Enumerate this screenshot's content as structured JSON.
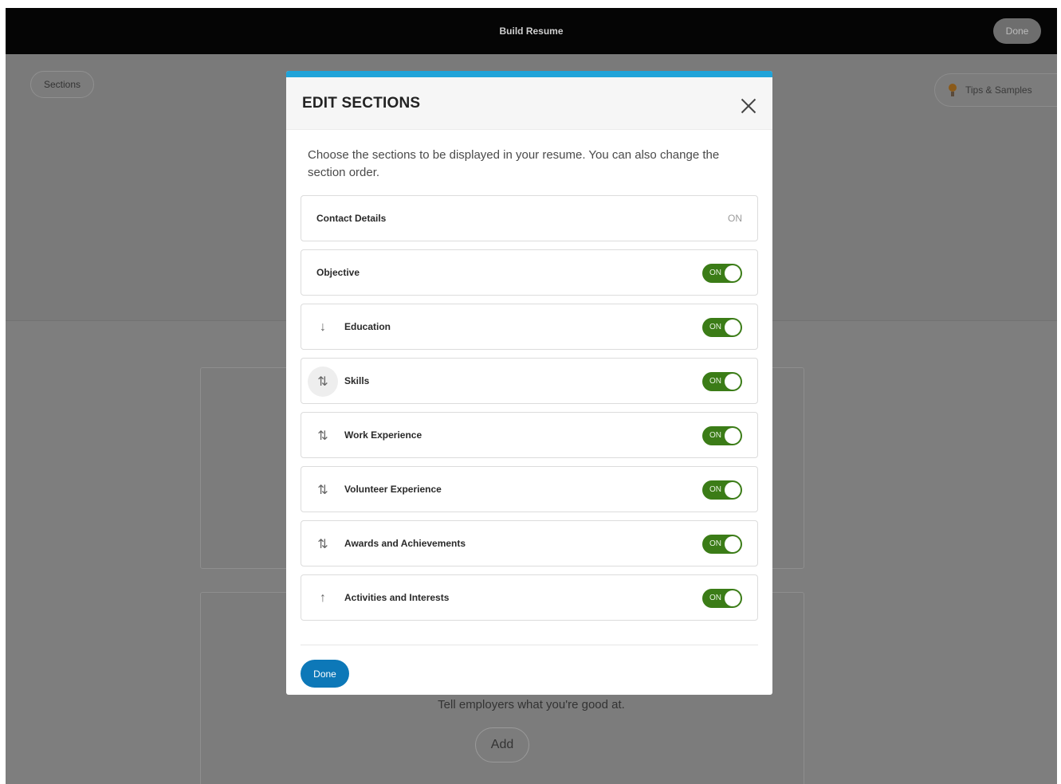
{
  "topbar": {
    "title": "Build Resume",
    "done_label": "Done"
  },
  "background": {
    "sections_label": "Sections",
    "tips_label": "Tips & Samples",
    "skills_card": {
      "description": "Tell employers what you're good at.",
      "add_label": "Add"
    }
  },
  "modal": {
    "title": "EDIT SECTIONS",
    "description": "Choose the sections to be displayed in your resume. You can also change the section order.",
    "done_label": "Done",
    "toggle_on_label": "ON",
    "rows": [
      {
        "label": "Contact Details",
        "status": "ON",
        "move_icon": "none",
        "toggle": "static"
      },
      {
        "label": "Objective",
        "status": "ON",
        "move_icon": "none",
        "toggle": "on"
      },
      {
        "label": "Education",
        "status": "ON",
        "move_icon": "↓",
        "toggle": "on"
      },
      {
        "label": "Skills",
        "status": "ON",
        "move_icon": "⇅",
        "toggle": "on"
      },
      {
        "label": "Work Experience",
        "status": "ON",
        "move_icon": "⇅",
        "toggle": "on"
      },
      {
        "label": "Volunteer Experience",
        "status": "ON",
        "move_icon": "⇅",
        "toggle": "on"
      },
      {
        "label": "Awards and Achievements",
        "status": "ON",
        "move_icon": "⇅",
        "toggle": "on"
      },
      {
        "label": "Activities and Interests",
        "status": "ON",
        "move_icon": "↑",
        "toggle": "on"
      }
    ]
  },
  "colors": {
    "accent": "#21a3d8",
    "toggle_on": "#3b7c17",
    "primary_button": "#0d78b8",
    "topbar": "#050505",
    "overlay": "#7a7a7a"
  }
}
